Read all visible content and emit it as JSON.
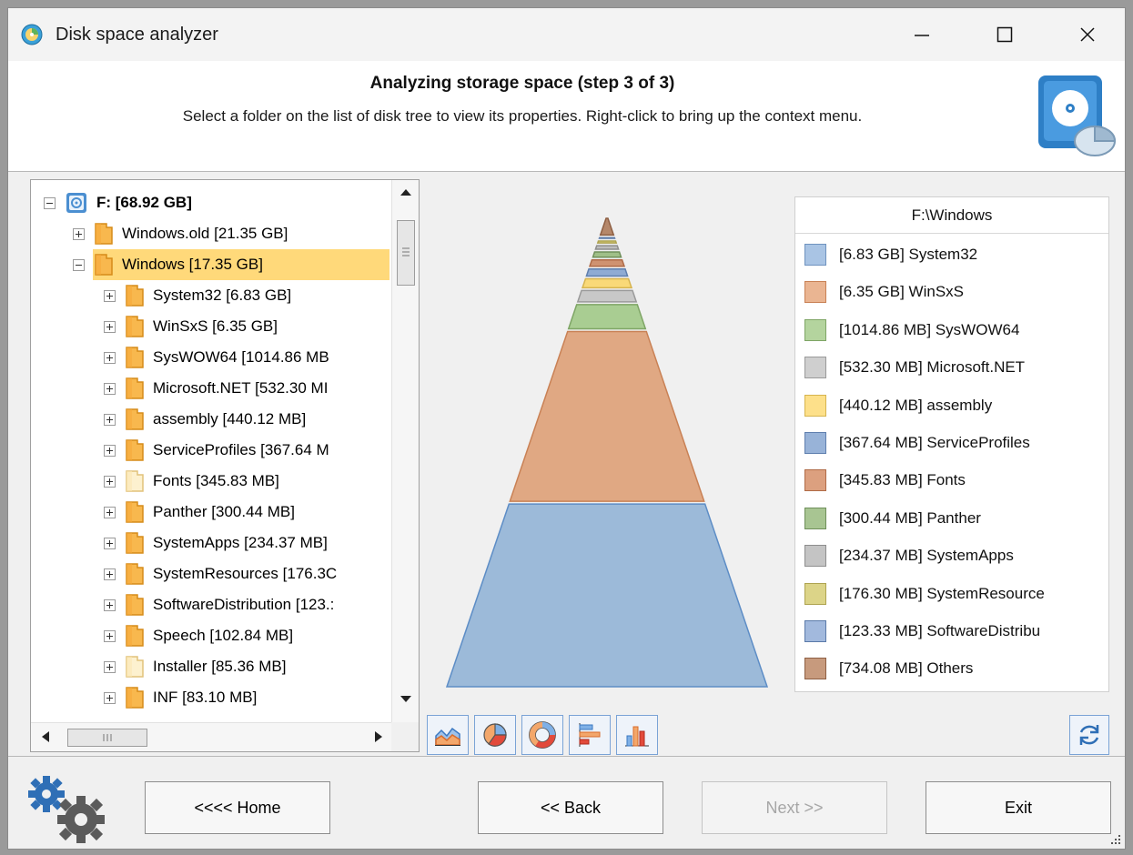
{
  "window": {
    "title": "Disk space analyzer"
  },
  "header": {
    "title": "Analyzing storage space (step 3 of 3)",
    "subtitle": "Select a folder on the list of disk tree to view its properties. Right-click to bring up the context menu."
  },
  "tree": {
    "root": "F: [68.92 GB]",
    "items": [
      {
        "label": "Windows.old [21.35 GB]",
        "level": 1,
        "expander": "plus",
        "folder": "dark"
      },
      {
        "label": "Windows [17.35 GB]",
        "level": 1,
        "expander": "minus",
        "folder": "open",
        "selected": true
      },
      {
        "label": "System32 [6.83 GB]",
        "level": 2,
        "expander": "plus",
        "folder": "dark"
      },
      {
        "label": "WinSxS [6.35 GB]",
        "level": 2,
        "expander": "plus",
        "folder": "dark"
      },
      {
        "label": "SysWOW64 [1014.86 MB",
        "level": 2,
        "expander": "plus",
        "folder": "dark"
      },
      {
        "label": "Microsoft.NET [532.30 MI",
        "level": 2,
        "expander": "plus",
        "folder": "dark"
      },
      {
        "label": "assembly [440.12 MB]",
        "level": 2,
        "expander": "plus",
        "folder": "dark"
      },
      {
        "label": "ServiceProfiles [367.64 M",
        "level": 2,
        "expander": "plus",
        "folder": "dark"
      },
      {
        "label": "Fonts [345.83 MB]",
        "level": 2,
        "expander": "plus",
        "folder": "light"
      },
      {
        "label": "Panther [300.44 MB]",
        "level": 2,
        "expander": "plus",
        "folder": "dark"
      },
      {
        "label": "SystemApps [234.37 MB]",
        "level": 2,
        "expander": "plus",
        "folder": "dark"
      },
      {
        "label": "SystemResources [176.3C",
        "level": 2,
        "expander": "plus",
        "folder": "dark"
      },
      {
        "label": "SoftwareDistribution [123.:",
        "level": 2,
        "expander": "plus",
        "folder": "dark"
      },
      {
        "label": "Speech [102.84 MB]",
        "level": 2,
        "expander": "plus",
        "folder": "dark"
      },
      {
        "label": "Installer [85.36 MB]",
        "level": 2,
        "expander": "plus",
        "folder": "light"
      },
      {
        "label": "INF [83.10 MB]",
        "level": 2,
        "expander": "plus",
        "folder": "dark"
      }
    ]
  },
  "legend": {
    "title": "F:\\Windows",
    "items": [
      {
        "label": "[6.83 GB] System32",
        "color": "#a9c4e4",
        "border": "#6f93bf"
      },
      {
        "label": "[6.35 GB] WinSxS",
        "color": "#eab592",
        "border": "#c98155"
      },
      {
        "label": "[1014.86 MB] SysWOW64",
        "color": "#b4d49e",
        "border": "#7ea565"
      },
      {
        "label": "[532.30 MB] Microsoft.NET",
        "color": "#cfcfcf",
        "border": "#9a9a9a"
      },
      {
        "label": "[440.12 MB] assembly",
        "color": "#fde08a",
        "border": "#d6b44f"
      },
      {
        "label": "[367.64 MB] ServiceProfiles",
        "color": "#98b3d8",
        "border": "#5f7fae"
      },
      {
        "label": "[345.83 MB] Fonts",
        "color": "#dca07f",
        "border": "#b06b47"
      },
      {
        "label": "[300.44 MB] Panther",
        "color": "#a8c592",
        "border": "#6f8f5a"
      },
      {
        "label": "[234.37 MB] SystemApps",
        "color": "#c4c4c4",
        "border": "#8e8e8e"
      },
      {
        "label": "[176.30 MB] SystemResource",
        "color": "#dcd488",
        "border": "#aea350"
      },
      {
        "label": "[123.33 MB] SoftwareDistribu",
        "color": "#a2b9dd",
        "border": "#5b7aa9"
      },
      {
        "label": "[734.08 MB] Others",
        "color": "#c79a7d",
        "border": "#8e5f43"
      }
    ]
  },
  "chart_data": {
    "type": "pyramid",
    "unit": "MB",
    "categories": [
      "System32",
      "WinSxS",
      "SysWOW64",
      "Microsoft.NET",
      "assembly",
      "ServiceProfiles",
      "Fonts",
      "Panther",
      "SystemApps",
      "SystemResource",
      "SoftwareDistribu",
      "Others"
    ],
    "values": [
      6993.92,
      6502.4,
      1014.86,
      532.3,
      440.12,
      367.64,
      345.83,
      300.44,
      234.37,
      176.3,
      123.33,
      734.08
    ],
    "colors": [
      "#9cbad9",
      "#e0a883",
      "#a9cd92",
      "#c8c8c8",
      "#f9d978",
      "#8fabd3",
      "#cf9271",
      "#9fbf88",
      "#bdbdbd",
      "#d6cd79",
      "#93afd8",
      "#b5876a"
    ],
    "borders": [
      "#5d8dc6",
      "#c98155",
      "#7ea565",
      "#9a9a9a",
      "#d6b44f",
      "#5f7fae",
      "#b06b47",
      "#6f8f5a",
      "#8e8e8e",
      "#aea350",
      "#5b7aa9",
      "#8e5f43"
    ]
  },
  "toolbar": {
    "icons": [
      "area-chart-icon",
      "pie-chart-icon",
      "doughnut-chart-icon",
      "bar-chart-icon",
      "column-chart-icon"
    ]
  },
  "buttons": {
    "home": "<<<< Home",
    "back": "<< Back",
    "next": "Next >>",
    "exit": "Exit"
  }
}
